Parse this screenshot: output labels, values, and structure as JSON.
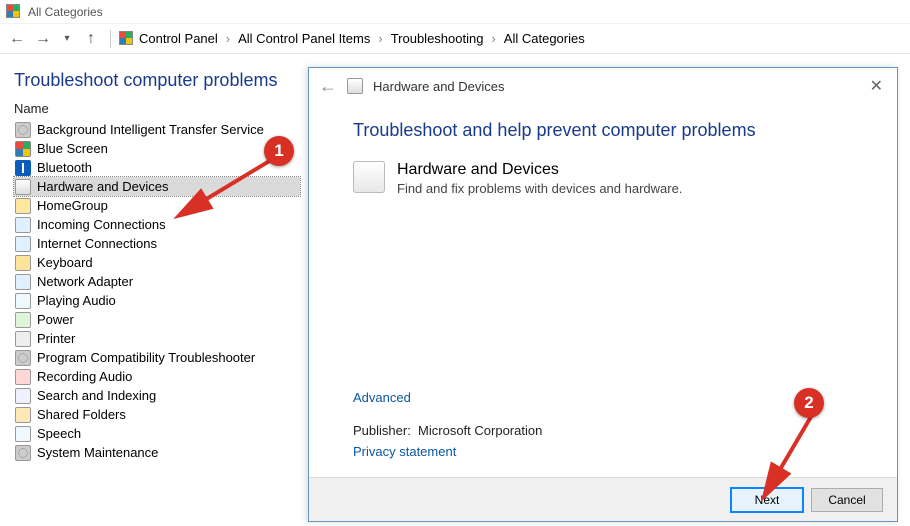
{
  "window": {
    "title": "All Categories"
  },
  "breadcrumb": [
    "Control Panel",
    "All Control Panel Items",
    "Troubleshooting",
    "All Categories"
  ],
  "page": {
    "heading": "Troubleshoot computer problems",
    "column_header": "Name"
  },
  "items": [
    {
      "label": "Background Intelligent Transfer Service",
      "icon": "gear"
    },
    {
      "label": "Blue Screen",
      "icon": "flag"
    },
    {
      "label": "Bluetooth",
      "icon": "bt"
    },
    {
      "label": "Hardware and Devices",
      "icon": "dev",
      "selected": true
    },
    {
      "label": "HomeGroup",
      "icon": "home"
    },
    {
      "label": "Incoming Connections",
      "icon": "net"
    },
    {
      "label": "Internet Connections",
      "icon": "net"
    },
    {
      "label": "Keyboard",
      "icon": "key"
    },
    {
      "label": "Network Adapter",
      "icon": "net"
    },
    {
      "label": "Playing Audio",
      "icon": "spk"
    },
    {
      "label": "Power",
      "icon": "pwr"
    },
    {
      "label": "Printer",
      "icon": "prn"
    },
    {
      "label": "Program Compatibility Troubleshooter",
      "icon": "gear"
    },
    {
      "label": "Recording Audio",
      "icon": "rec"
    },
    {
      "label": "Search and Indexing",
      "icon": "srch"
    },
    {
      "label": "Shared Folders",
      "icon": "fld"
    },
    {
      "label": "Speech",
      "icon": "spk"
    },
    {
      "label": "System Maintenance",
      "icon": "gear"
    }
  ],
  "dialog": {
    "top_title": "Hardware and Devices",
    "heading": "Troubleshoot and help prevent computer problems",
    "item_title": "Hardware and Devices",
    "item_desc": "Find and fix problems with devices and hardware.",
    "advanced": "Advanced",
    "publisher_label": "Publisher:",
    "publisher_value": "Microsoft Corporation",
    "privacy": "Privacy statement",
    "buttons": {
      "next": "Next",
      "cancel": "Cancel"
    }
  },
  "callouts": {
    "one": "1",
    "two": "2"
  }
}
